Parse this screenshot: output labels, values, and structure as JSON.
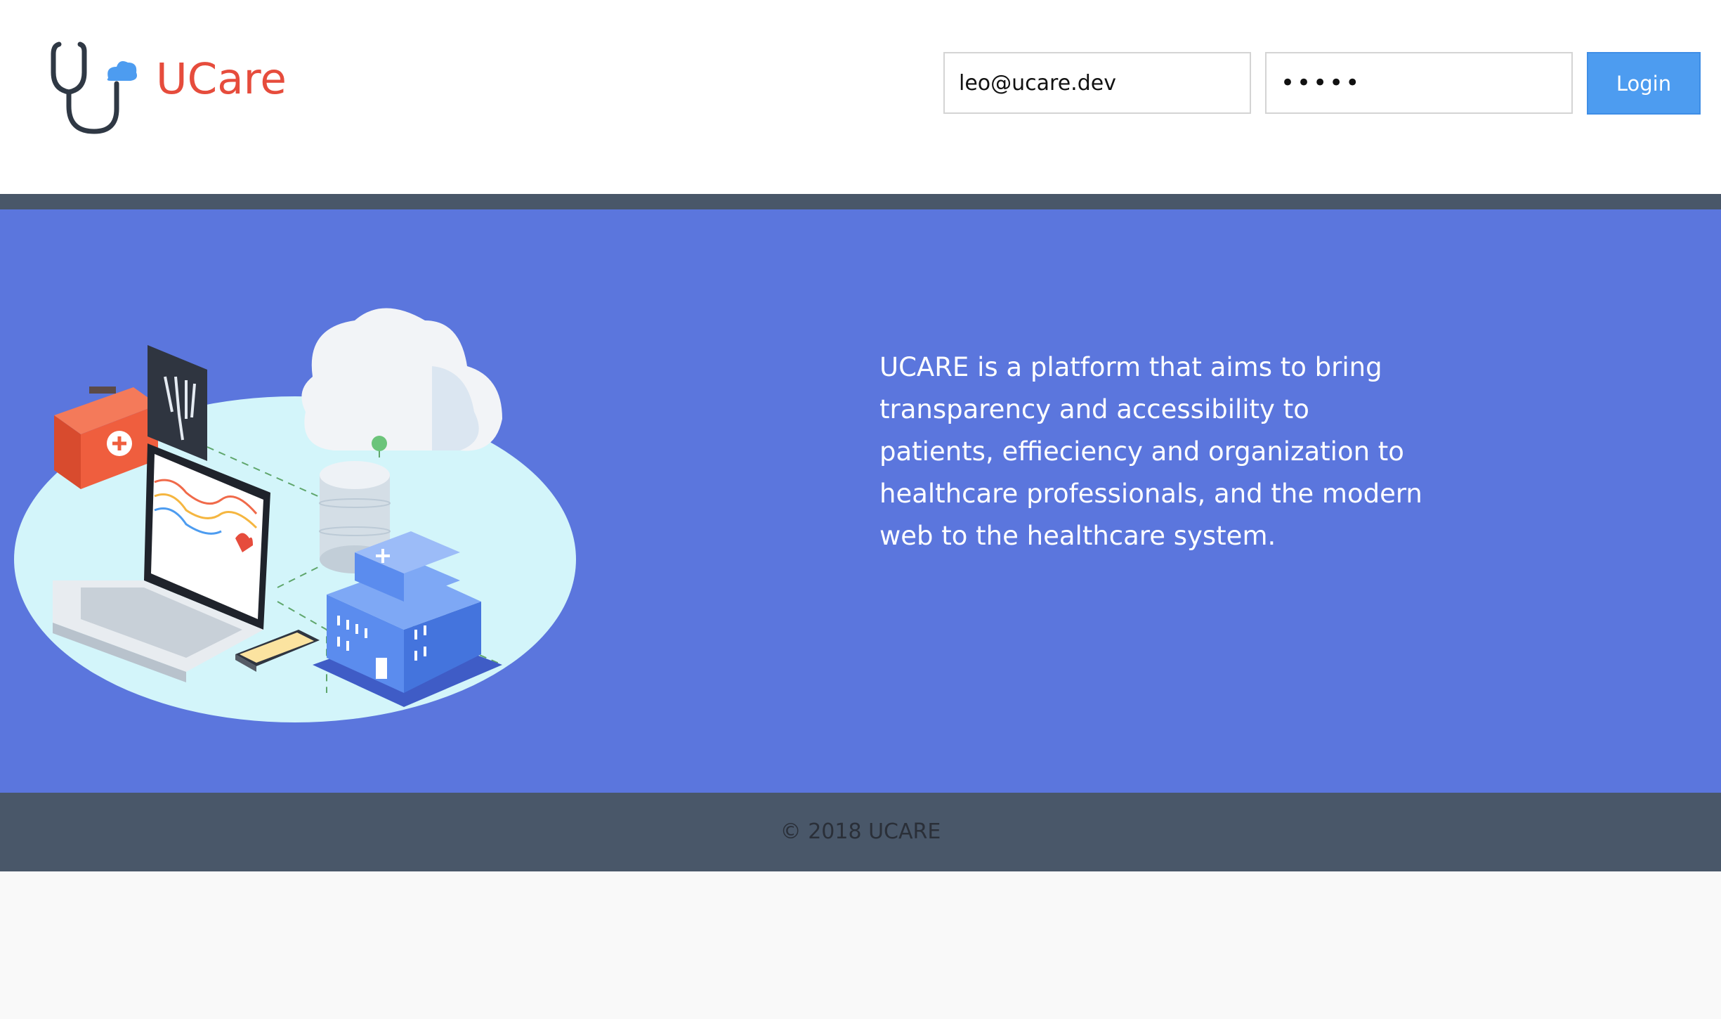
{
  "app": {
    "brand_name": "UCare",
    "logo_icon": "stethoscope-cloud-icon"
  },
  "login": {
    "email_value": "leo@ucare.dev",
    "password_value": "•••••",
    "login_label": "Login"
  },
  "hero": {
    "description": "UCARE is a platform that aims to bring transparency and accessibility to patients, effieciency and organization to healthcare professionals, and the modern web to the healthcare system.",
    "illustration_icon": "healthcare-network-illustration"
  },
  "footer": {
    "copyright": "© 2018 UCARE"
  },
  "colors": {
    "brand": "#e64c3c",
    "hero_background": "#5b76dd",
    "footer_background": "#495769",
    "button_background": "#4d9cf0"
  }
}
